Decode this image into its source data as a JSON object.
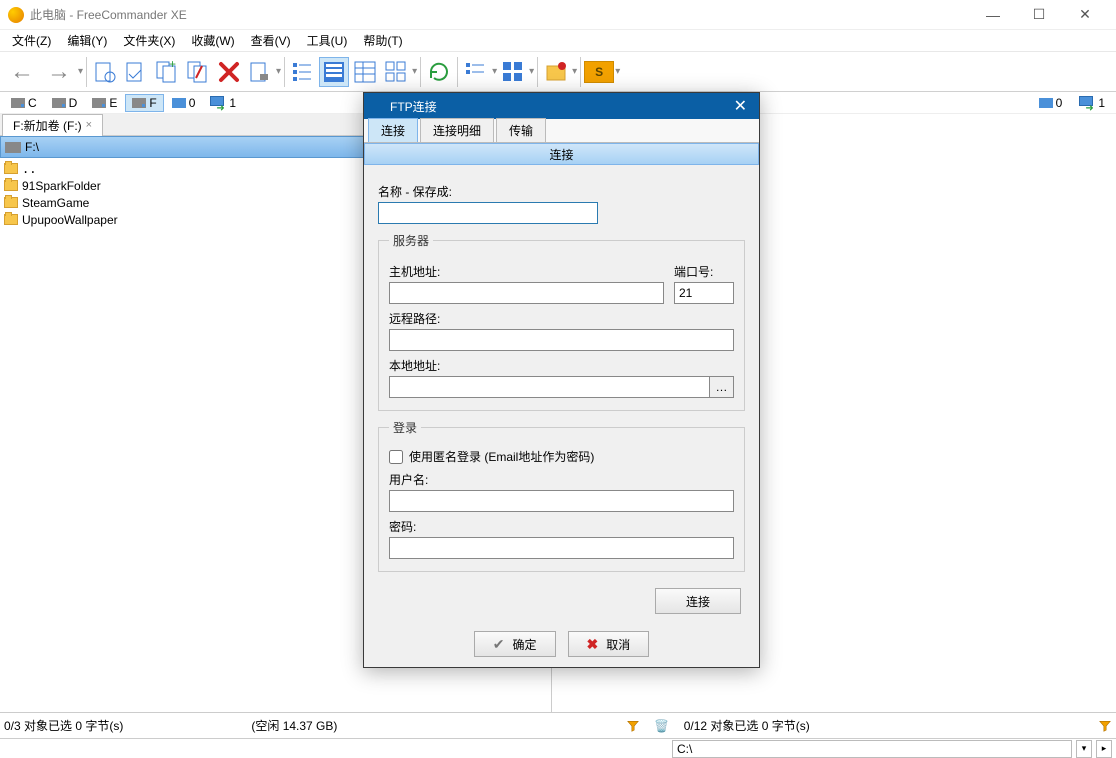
{
  "titlebar": {
    "title": "此电脑 - FreeCommander XE"
  },
  "menu": {
    "file": "文件(Z)",
    "edit": "编辑(Y)",
    "folder": "文件夹(X)",
    "fav": "收藏(W)",
    "view": "查看(V)",
    "tools": "工具(U)",
    "help": "帮助(T)"
  },
  "drives": {
    "left": [
      "C",
      "D",
      "E",
      "F"
    ],
    "left_net": "0",
    "left_remote": "1",
    "right_net": "0",
    "right_remote": "1"
  },
  "left_panel": {
    "tab": "F:新加卷 (F:)",
    "path": "F:\\",
    "items": [
      {
        "name": ".."
      },
      {
        "name": "91SparkFolder"
      },
      {
        "name": "SteamGame"
      },
      {
        "name": "UpupooWallpaper"
      }
    ],
    "status_sel": "0/3 对象已选  0 字节(s)",
    "status_free": "(空闲 14.37 GB)"
  },
  "right_panel": {
    "status_sel": "0/12 对象已选  0 字节(s)"
  },
  "cmdbar": {
    "path": "C:\\"
  },
  "dialog": {
    "title": "FTP连接",
    "tabs": {
      "t1": "连接",
      "t2": "连接明细",
      "t3": "传输"
    },
    "section": "连接",
    "name_label": "名称 - 保存成:",
    "name_value": "",
    "server_legend": "服务器",
    "host_label": "主机地址:",
    "host_value": "",
    "port_label": "端口号:",
    "port_value": "21",
    "remote_label": "远程路径:",
    "remote_value": "",
    "local_label": "本地地址:",
    "local_value": "",
    "login_legend": "登录",
    "anon_label": "使用匿名登录 (Email地址作为密码)",
    "user_label": "用户名:",
    "user_value": "",
    "pass_label": "密码:",
    "pass_value": "",
    "connect_btn": "连接",
    "ok_btn": "确定",
    "cancel_btn": "取消"
  }
}
